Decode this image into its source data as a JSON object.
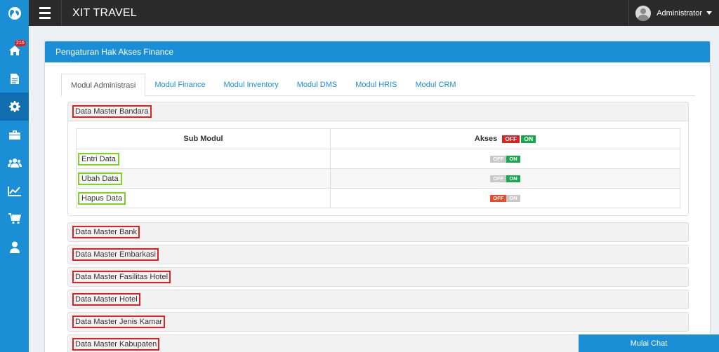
{
  "app": {
    "title": "XIT TRAVEL"
  },
  "user": {
    "name": "Administrator"
  },
  "sidebar": {
    "badge": "216",
    "items": [
      {
        "icon": "home-icon"
      },
      {
        "icon": "document-icon"
      },
      {
        "icon": "gear-icon"
      },
      {
        "icon": "briefcase-icon"
      },
      {
        "icon": "users-icon"
      },
      {
        "icon": "chart-line-icon"
      },
      {
        "icon": "cart-icon"
      },
      {
        "icon": "user-icon"
      }
    ]
  },
  "panel": {
    "title": "Pengaturan Hak Akses Finance"
  },
  "tabs": [
    {
      "label": "Modul Administrasi",
      "active": true
    },
    {
      "label": "Modul Finance"
    },
    {
      "label": "Modul Inventory"
    },
    {
      "label": "Modul DMS"
    },
    {
      "label": "Modul HRIS"
    },
    {
      "label": "Modul CRM"
    }
  ],
  "table": {
    "col_submodul": "Sub Modul",
    "col_akses": "Akses",
    "head_off": "OFF",
    "head_on": "ON",
    "rows": [
      {
        "name": "Entri Data",
        "off": "OFF",
        "on": "ON",
        "state": "on"
      },
      {
        "name": "Ubah Data",
        "off": "OFF",
        "on": "ON",
        "state": "on"
      },
      {
        "name": "Hapus Data",
        "off": "OFF",
        "on": "ON",
        "state": "off"
      }
    ]
  },
  "sections": [
    "Data Master Bandara",
    "Data Master Bank",
    "Data Master Embarkasi",
    "Data Master Fasilitas Hotel",
    "Data Master Hotel",
    "Data Master Jenis Kamar",
    "Data Master Kabupaten"
  ],
  "chat": {
    "label": "Mulai Chat"
  },
  "colors": {
    "primary": "#1a8fd6",
    "topbar": "#2b2b2b",
    "off": "#e84a2e",
    "on": "#1aa84e"
  }
}
